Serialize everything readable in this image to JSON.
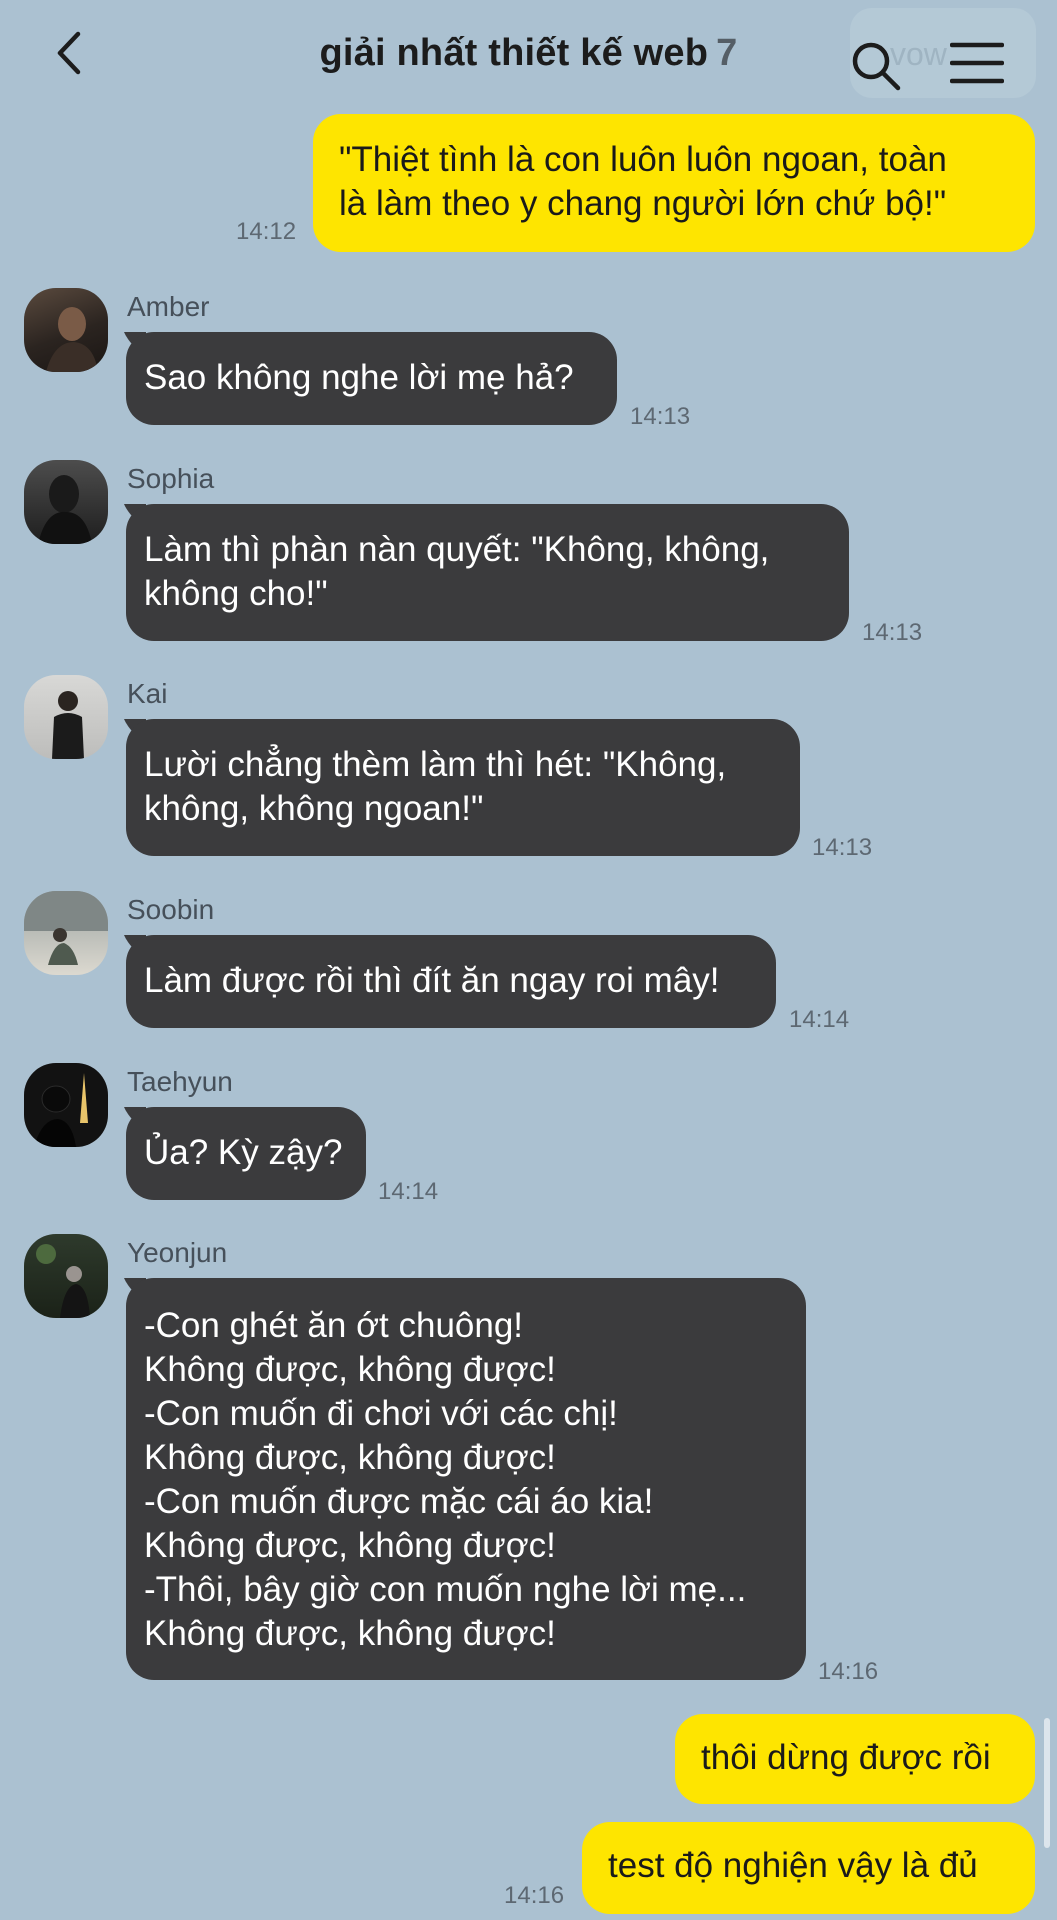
{
  "header": {
    "title": "giải nhất thiết kế web",
    "member_count": "7",
    "ghost_chip": "vow"
  },
  "messages": [
    {
      "from": "me",
      "text": "\"Thiệt tình là con luôn luôn ngoan, toàn\nlà làm theo y chang người lớn chứ bộ!\"",
      "time": "14:12"
    },
    {
      "from": "Amber",
      "text": "Sao không nghe lời mẹ hả?",
      "time": "14:13"
    },
    {
      "from": "Sophia",
      "text": "Làm thì phàn nàn quyết: \"Không, không,\nkhông cho!\"",
      "time": "14:13"
    },
    {
      "from": "Kai",
      "text": "Lười chẳng thèm làm thì hét: \"Không,\nkhông, không ngoan!\"",
      "time": "14:13"
    },
    {
      "from": "Soobin",
      "text": "Làm được rồi thì đít ăn ngay roi mây!",
      "time": "14:14"
    },
    {
      "from": "Taehyun",
      "text": "Ủa? Kỳ zậy?",
      "time": "14:14"
    },
    {
      "from": "Yeonjun",
      "text": "-Con ghét ăn ớt chuông!\nKhông được, không được!\n-Con muốn đi chơi với các chị!\nKhông được, không được!\n-Con muốn được mặc cái áo kia!\nKhông được, không được!\n-Thôi, bây giờ con muốn nghe lời mẹ...\nKhông được, không được!",
      "time": "14:16"
    },
    {
      "from": "me",
      "text": "thôi dừng được rồi",
      "time": ""
    },
    {
      "from": "me",
      "text": "test độ nghiện vậy là đủ",
      "time": "14:16"
    }
  ],
  "colors": {
    "background": "#abc1d1",
    "my_bubble": "#fee500",
    "their_bubble": "#3b3b3d"
  }
}
